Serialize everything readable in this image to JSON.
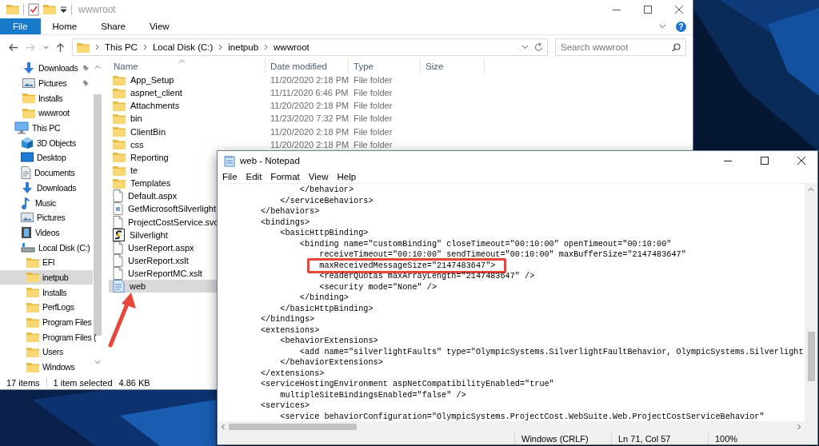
{
  "explorer": {
    "title": "wwwroot",
    "ribbon_tabs": [
      {
        "label": "File",
        "selected": true
      },
      {
        "label": "Home",
        "selected": false
      },
      {
        "label": "Share",
        "selected": false
      },
      {
        "label": "View",
        "selected": false
      }
    ],
    "help_button": "?",
    "address": [
      "This PC",
      "Local Disk (C:)",
      "inetpub",
      "wwwroot"
    ],
    "search": {
      "placeholder": "Search wwwroot"
    },
    "nav": {
      "quick_access": [
        {
          "label": "Downloads",
          "kind": "downloads",
          "pinned": true,
          "selected": false
        },
        {
          "label": "Pictures",
          "kind": "pictures",
          "pinned": true,
          "selected": false
        },
        {
          "label": "Installs",
          "kind": "folder",
          "pinned": false,
          "selected": false
        },
        {
          "label": "wwwroot",
          "kind": "folder",
          "pinned": false,
          "selected": false
        }
      ],
      "tree": [
        {
          "label": "This PC",
          "kind": "pc",
          "selected": false,
          "children": [
            {
              "label": "3D Objects",
              "kind": "objects",
              "selected": false
            },
            {
              "label": "Desktop",
              "kind": "desktop",
              "selected": false
            },
            {
              "label": "Documents",
              "kind": "documents",
              "selected": false
            },
            {
              "label": "Downloads",
              "kind": "downloads",
              "selected": false
            },
            {
              "label": "Music",
              "kind": "music",
              "selected": false
            },
            {
              "label": "Pictures",
              "kind": "pictures",
              "selected": false
            },
            {
              "label": "Videos",
              "kind": "videos",
              "selected": false
            },
            {
              "label": "Local Disk (C:)",
              "kind": "disk",
              "selected": false,
              "children": [
                {
                  "label": "EFI",
                  "kind": "folder",
                  "selected": false
                },
                {
                  "label": "inetpub",
                  "kind": "folder",
                  "selected": true
                },
                {
                  "label": "Installs",
                  "kind": "folder",
                  "selected": false
                },
                {
                  "label": "PerfLogs",
                  "kind": "folder",
                  "selected": false
                },
                {
                  "label": "Program Files",
                  "kind": "folder",
                  "selected": false
                },
                {
                  "label": "Program Files (",
                  "kind": "folder",
                  "selected": false
                },
                {
                  "label": "Users",
                  "kind": "folder",
                  "selected": false
                },
                {
                  "label": "Windows",
                  "kind": "folder",
                  "selected": false
                }
              ]
            }
          ]
        }
      ]
    },
    "columns": [
      "Name",
      "Date modified",
      "Type",
      "Size"
    ],
    "files": [
      {
        "name": "App_Setup",
        "kind": "folder",
        "date": "11/20/2020 2:18 PM",
        "type": "File folder",
        "selected": false
      },
      {
        "name": "aspnet_client",
        "kind": "folder",
        "date": "11/11/2020 6:46 PM",
        "type": "File folder",
        "selected": false
      },
      {
        "name": "Attachments",
        "kind": "folder",
        "date": "11/20/2020 2:18 PM",
        "type": "File folder",
        "selected": false
      },
      {
        "name": "bin",
        "kind": "folder",
        "date": "11/23/2020 7:32 PM",
        "type": "File folder",
        "selected": false
      },
      {
        "name": "ClientBin",
        "kind": "folder",
        "date": "11/20/2020 2:18 PM",
        "type": "File folder",
        "selected": false
      },
      {
        "name": "css",
        "kind": "folder",
        "date": "11/20/2020 2:18 PM",
        "type": "File folder",
        "selected": false
      },
      {
        "name": "Reporting",
        "kind": "folder",
        "selected": false
      },
      {
        "name": "te",
        "kind": "folder",
        "selected": false
      },
      {
        "name": "Templates",
        "kind": "folder",
        "selected": false
      },
      {
        "name": "Default.aspx",
        "kind": "file",
        "selected": false
      },
      {
        "name": "GetMicrosoftSilverlight",
        "kind": "webpage",
        "selected": false
      },
      {
        "name": "ProjectCostService.svc",
        "kind": "file",
        "selected": false
      },
      {
        "name": "Silverlight",
        "kind": "app",
        "selected": false
      },
      {
        "name": "UserReport.aspx",
        "kind": "file",
        "selected": false
      },
      {
        "name": "UserReport.xslt",
        "kind": "file",
        "selected": false
      },
      {
        "name": "UserReportMC.xslt",
        "kind": "file",
        "selected": false
      },
      {
        "name": "web",
        "kind": "config",
        "selected": true
      }
    ],
    "status": {
      "count": "17 items",
      "selection": "1 item selected",
      "size": "4.86 KB"
    }
  },
  "notepad": {
    "title": "web - Notepad",
    "menu": [
      "File",
      "Edit",
      "Format",
      "View",
      "Help"
    ],
    "lines": [
      {
        "text": "                </behavior>",
        "highlighted": false
      },
      {
        "text": "            </serviceBehaviors>",
        "highlighted": false
      },
      {
        "text": "        </behaviors>",
        "highlighted": false
      },
      {
        "text": "        <bindings>",
        "highlighted": false
      },
      {
        "text": "            <basicHttpBinding>",
        "highlighted": false
      },
      {
        "text": "                <binding name=\"customBinding\" closeTimeout=\"00:10:00\" openTimeout=\"00:10:00\"",
        "highlighted": false
      },
      {
        "text": "                    receiveTimeout=\"00:10:00\" sendTimeout=\"00:10:00\" maxBufferSize=\"2147483647\"",
        "highlighted": false
      },
      {
        "text": "                    maxReceivedMessageSize=\"2147483647\">",
        "highlighted": true
      },
      {
        "text": "                    <readerQuotas maxArrayLength=\"2147483647\" />",
        "highlighted": false
      },
      {
        "text": "                    <security mode=\"None\" />",
        "highlighted": false
      },
      {
        "text": "                </binding>",
        "highlighted": false
      },
      {
        "text": "            </basicHttpBinding>",
        "highlighted": false
      },
      {
        "text": "        </bindings>",
        "highlighted": false
      },
      {
        "text": "        <extensions>",
        "highlighted": false
      },
      {
        "text": "            <behaviorExtensions>",
        "highlighted": false
      },
      {
        "text": "                <add name=\"silverlightFaults\" type=\"OlympicSystems.SilverlightFaultBehavior, OlympicSystems.Silverlight",
        "highlighted": false
      },
      {
        "text": "            </behaviorExtensions>",
        "highlighted": false
      },
      {
        "text": "        </extensions>",
        "highlighted": false
      },
      {
        "text": "        <serviceHostingEnvironment aspNetCompatibilityEnabled=\"true\"",
        "highlighted": false
      },
      {
        "text": "            multipleSiteBindingsEnabled=\"false\" />",
        "highlighted": false
      },
      {
        "text": "        <services>",
        "highlighted": false
      },
      {
        "text": "            <service behaviorConfiguration=\"OlympicSystems.ProjectCost.WebSuite.Web.ProjectCostServiceBehavior\"",
        "highlighted": false
      }
    ],
    "status": [
      "Windows (CRLF)",
      "Ln 71, Col 57",
      "100%"
    ]
  }
}
